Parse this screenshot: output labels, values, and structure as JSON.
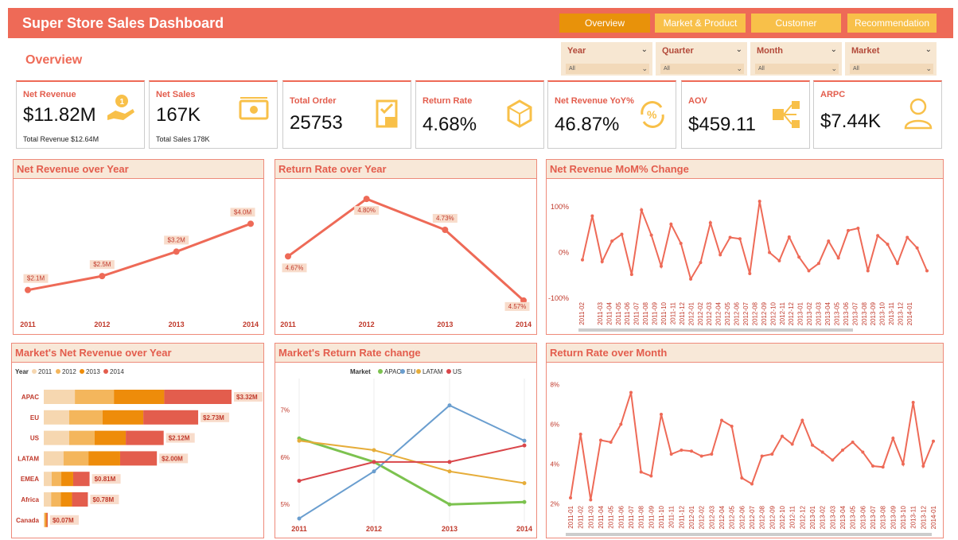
{
  "header": {
    "title": "Super Store Sales Dashboard",
    "nav": [
      "Overview",
      "Market & Product",
      "Customer",
      "Recommendation"
    ],
    "active_tab": 0,
    "colors": {
      "bar": "#ee6a57",
      "active": "#e8920a",
      "inactive": "#f8c049"
    }
  },
  "page_title": "Overview",
  "filters": [
    {
      "label": "Year",
      "value": "All"
    },
    {
      "label": "Quarter",
      "value": "All"
    },
    {
      "label": "Month",
      "value": "All"
    },
    {
      "label": "Market",
      "value": "All"
    }
  ],
  "kpis": [
    {
      "label": "Net Revenue",
      "value": "$11.82M",
      "sub": "Total Revenue $12.64M",
      "icon": "money-hand-icon"
    },
    {
      "label": "Net Sales",
      "value": "167K",
      "sub": "Total Sales 178K",
      "icon": "banknote-icon"
    },
    {
      "label": "Total Order",
      "value": "25753",
      "sub": "",
      "icon": "clipboard-box-icon"
    },
    {
      "label": "Return Rate",
      "value": "4.68%",
      "sub": "",
      "icon": "return-box-icon"
    },
    {
      "label": "Net Revenue YoY%",
      "value": "46.87%",
      "sub": "",
      "icon": "percent-cycle-icon"
    },
    {
      "label": "AOV",
      "value": "$459.11",
      "sub": "",
      "icon": "network-boxes-icon"
    },
    {
      "label": "ARPC",
      "value": "$7.44K",
      "sub": "",
      "icon": "person-icon"
    }
  ],
  "panels": {
    "net_revenue_year": "Net Revenue over Year",
    "return_rate_year": "Return Rate over Year",
    "mom_change": "Net Revenue MoM% Change",
    "market_revenue": "Market's Net Revenue over Year",
    "market_return": "Market's Return Rate change",
    "return_month": "Return Rate over Month"
  },
  "chart_data": [
    {
      "id": "net_revenue_year",
      "type": "line",
      "x": [
        "2011",
        "2012",
        "2013",
        "2014"
      ],
      "values": [
        2.1,
        2.5,
        3.2,
        4.0
      ],
      "labels": [
        "$2.1M",
        "$2.5M",
        "$3.2M",
        "$4.0M"
      ],
      "ylim": [
        1.5,
        4.6
      ],
      "color": "#ee6a57"
    },
    {
      "id": "return_rate_year",
      "type": "line",
      "x": [
        "2011",
        "2012",
        "2013",
        "2014"
      ],
      "values": [
        4.67,
        4.8,
        4.73,
        4.57
      ],
      "labels": [
        "4.67%",
        "4.80%",
        "4.73%",
        "4.57%"
      ],
      "ylim": [
        4.55,
        4.82
      ],
      "color": "#ee6a57"
    },
    {
      "id": "mom_change",
      "type": "line",
      "yticks": [
        "100%",
        "0%",
        "-100%"
      ],
      "ylim": [
        -100,
        100
      ],
      "x": [
        "2011-02",
        "2011-03",
        "2011-04",
        "2011-05",
        "2011-06",
        "2011-07",
        "2011-08",
        "2011-09",
        "2011-10",
        "2011-11",
        "2011-12",
        "2012-01",
        "2012-02",
        "2012-03",
        "2012-04",
        "2012-05",
        "2012-06",
        "2012-07",
        "2012-08",
        "2012-09",
        "2012-10",
        "2012-11",
        "2012-12",
        "2013-01",
        "2013-02",
        "2013-03",
        "2013-04",
        "2013-05",
        "2013-06",
        "2013-07",
        "2013-08",
        "2013-09",
        "2013-10",
        "2013-11",
        "2013-12",
        "2014-01"
      ],
      "x_axis": [
        "2011-02",
        "",
        "2011-03",
        "2011-04",
        "2011-05",
        "2011-06",
        "2011-07",
        "2011-08",
        "2011-09",
        "2011-10",
        "2011-11",
        "2011-12",
        "2012-01",
        "2012-02",
        "2012-03",
        "2012-04",
        "2012-05",
        "2012-06",
        "2012-07",
        "2012-08",
        "2012-09",
        "2012-10",
        "2012-11",
        "2012-12",
        "2013-01",
        "2013-02",
        "2013-03",
        "2013-04",
        "2013-05",
        "2013-06",
        "2013-07",
        "2013-08",
        "2013-09",
        "2013-10",
        "2013-11",
        "2013-12",
        "2014-01"
      ],
      "values": [
        -16,
        80,
        -20,
        25,
        40,
        -48,
        93,
        38,
        -30,
        62,
        20,
        -58,
        -22,
        65,
        -5,
        33,
        30,
        -46,
        112,
        0,
        -18,
        34,
        -10,
        -40,
        -24,
        25,
        -12,
        48,
        53,
        -40,
        37,
        18,
        -24,
        33,
        10,
        -40
      ],
      "color": "#ee6a57"
    },
    {
      "id": "market_revenue",
      "type": "bar",
      "stacked": true,
      "orientation": "horizontal",
      "legend_title": "Year",
      "series_names": [
        "2011",
        "2012",
        "2013",
        "2014"
      ],
      "series_colors": [
        "#f6d7b0",
        "#f4b65c",
        "#ee8c0a",
        "#e35d4d"
      ],
      "categories": [
        "APAC",
        "EU",
        "US",
        "LATAM",
        "EMEA",
        "Africa",
        "Canada"
      ],
      "totals": [
        3.32,
        2.73,
        2.12,
        2.0,
        0.81,
        0.78,
        0.07
      ],
      "total_labels": [
        "$3.32M",
        "$2.73M",
        "$2.12M",
        "$2.00M",
        "$0.81M",
        "$0.78M",
        "$0.07M"
      ],
      "series": [
        {
          "name": "2011",
          "values": [
            0.55,
            0.45,
            0.45,
            0.35,
            0.14,
            0.13,
            0.01
          ]
        },
        {
          "name": "2012",
          "values": [
            0.69,
            0.59,
            0.45,
            0.44,
            0.17,
            0.17,
            0.02
          ]
        },
        {
          "name": "2013",
          "values": [
            0.89,
            0.72,
            0.55,
            0.56,
            0.21,
            0.2,
            0.02
          ]
        },
        {
          "name": "2014",
          "values": [
            1.19,
            0.97,
            0.67,
            0.65,
            0.29,
            0.28,
            0.02
          ]
        }
      ],
      "xlim": [
        0,
        3.32
      ]
    },
    {
      "id": "market_return",
      "type": "line",
      "legend_title": "Market",
      "x": [
        "2011",
        "2012",
        "2013",
        "2014"
      ],
      "yticks": [
        "7%",
        "6%",
        "5%"
      ],
      "ylim": [
        4.7,
        7.5
      ],
      "series": [
        {
          "name": "APAC",
          "color": "#7cc24f",
          "values": [
            6.4,
            5.9,
            5.0,
            5.05
          ]
        },
        {
          "name": "EU",
          "color": "#6a9ecf",
          "values": [
            4.7,
            5.7,
            7.1,
            6.35
          ]
        },
        {
          "name": "LATAM",
          "color": "#e6ad3a",
          "values": [
            6.35,
            6.15,
            5.7,
            5.45
          ]
        },
        {
          "name": "US",
          "color": "#d9464a",
          "values": [
            5.5,
            5.9,
            5.9,
            6.25
          ]
        }
      ]
    },
    {
      "id": "return_month",
      "type": "line",
      "yticks": [
        "8%",
        "6%",
        "4%",
        "2%"
      ],
      "ylim": [
        1.5,
        8.5
      ],
      "x": [
        "2011-01",
        "2011-02",
        "2011-03",
        "2011-04",
        "2011-05",
        "2011-06",
        "2011-07",
        "2011-08",
        "2011-09",
        "2011-10",
        "2011-11",
        "2011-12",
        "2012-01",
        "2012-02",
        "2012-03",
        "2012-04",
        "2012-05",
        "2012-06",
        "2012-07",
        "2012-08",
        "2012-09",
        "2012-10",
        "2012-11",
        "2012-12",
        "2013-01",
        "2013-02",
        "2013-03",
        "2013-04",
        "2013-05",
        "2013-06",
        "2013-07",
        "2013-08",
        "2013-09",
        "2013-10",
        "2013-11",
        "2013-12",
        "2014-01"
      ],
      "x_axis": [
        "2011-01",
        "2011-02",
        "2011-03",
        "2011-04",
        "2011-05",
        "2011-06",
        "2011-07",
        "2011-08",
        "2011-09",
        "2011-10",
        "2011-11",
        "2011-12",
        "2012-01",
        "2012-02",
        "2012-03",
        "2012-04",
        "2012-05",
        "2012-06",
        "2012-07",
        "2012-08",
        "2012-09",
        "2012-10",
        "2012-11",
        "2012-12",
        "2013-01",
        "2013-02",
        "2013-03",
        "2013-04",
        "2013-05",
        "2013-06",
        "2013-07",
        "2013-08",
        "2013-09",
        "2013-10",
        "2013-11",
        "2013-12",
        "2014-01"
      ],
      "values": [
        2.3,
        5.5,
        2.2,
        5.2,
        5.1,
        6.0,
        7.6,
        3.6,
        3.4,
        6.5,
        4.5,
        4.7,
        4.65,
        4.4,
        4.5,
        6.2,
        5.9,
        3.3,
        3.0,
        4.4,
        4.5,
        5.4,
        5.0,
        6.2,
        4.95,
        4.6,
        4.2,
        4.7,
        5.1,
        4.6,
        3.9,
        3.85,
        5.3,
        4.0,
        7.1,
        3.9,
        5.15
      ],
      "color": "#ee6a57"
    }
  ]
}
